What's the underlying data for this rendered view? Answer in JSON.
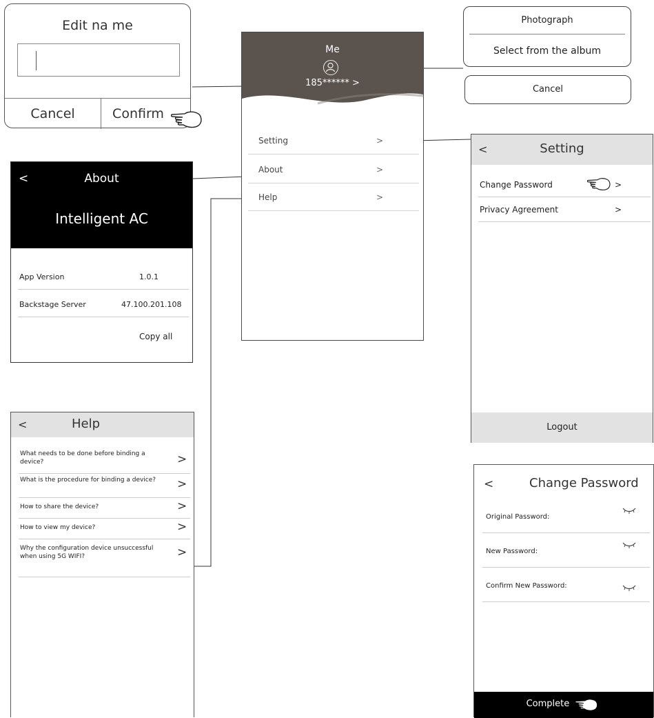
{
  "edit_name_dialog": {
    "title": "Edit na me",
    "cancel_label": "Cancel",
    "confirm_label": "Confirm"
  },
  "me_screen": {
    "title": "Me",
    "phone": "185****** >",
    "menu": [
      {
        "label": "Setting",
        "arrow": ">"
      },
      {
        "label": "About",
        "arrow": ">"
      },
      {
        "label": "Help",
        "arrow": ">"
      }
    ]
  },
  "photo_sheet": {
    "option_photograph": "Photograph",
    "option_album": "Select from the album",
    "cancel_label": "Cancel"
  },
  "about_screen": {
    "back": "<",
    "title": "About",
    "app_name": "Intelligent AC",
    "rows": [
      {
        "key": "App Version",
        "value": "1.0.1"
      },
      {
        "key": "Backstage Server",
        "value": "47.100.201.108"
      }
    ],
    "copy_all": "Copy all"
  },
  "setting_screen": {
    "back": "<",
    "title": "Setting",
    "rows": [
      {
        "label": "Change Password",
        "arrow": ">"
      },
      {
        "label": "Privacy Agreement",
        "arrow": ">"
      }
    ],
    "logout": "Logout"
  },
  "help_screen": {
    "back": "<",
    "title": "Help",
    "questions": [
      "What needs to be done  before binding a device?",
      "What is the procedure for  binding a device?",
      "How to share the device?",
      "How to view my device?",
      "Why the configuration device unsuccessful when using 5G WIFI?"
    ],
    "chevron": ">"
  },
  "change_password_screen": {
    "back": "<",
    "title": "Change Password",
    "fields": [
      {
        "label": "Original Password:"
      },
      {
        "label": "New Password:"
      },
      {
        "label": "Confirm New Password:"
      }
    ],
    "complete": "Complete"
  }
}
